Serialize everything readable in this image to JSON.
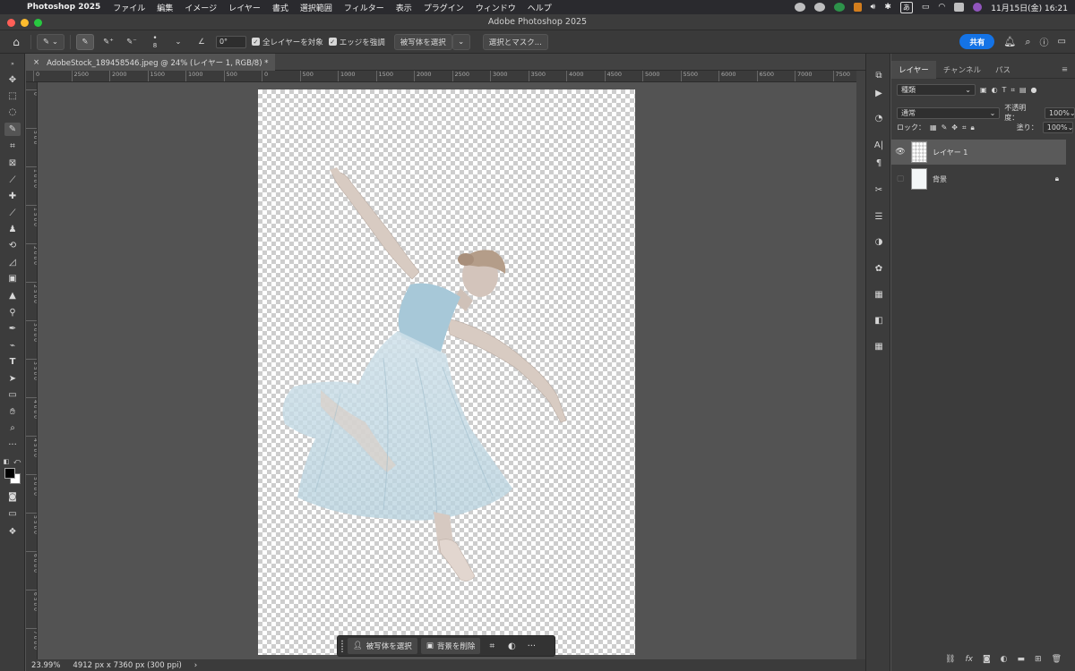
{
  "menubar": {
    "app": "Photoshop 2025",
    "menus": [
      "ファイル",
      "編集",
      "イメージ",
      "レイヤー",
      "書式",
      "選択範囲",
      "フィルター",
      "表示",
      "プラグイン",
      "ウィンドウ",
      "ヘルプ"
    ],
    "input_method": "あ",
    "datetime": "11月15日(金)  16:21"
  },
  "window": {
    "title": "Adobe Photoshop 2025"
  },
  "options": {
    "brush_size": "8",
    "angle": "0°",
    "sample_all_layers": "全レイヤーを対象",
    "enhance_edge": "エッジを強調",
    "select_subject": "被写体を選択",
    "select_mask": "選択とマスク...",
    "share": "共有"
  },
  "document": {
    "tab_title": "AdobeStock_189458546.jpeg @ 24% (レイヤー 1, RGB/8) *",
    "close": "×"
  },
  "ruler": {
    "h_labels": [
      "0",
      "2500",
      "2000",
      "1500",
      "1000",
      "500",
      "0",
      "500",
      "1000",
      "1500",
      "2000",
      "2500",
      "3000",
      "3500",
      "4000",
      "4500",
      "5000",
      "5500",
      "6000",
      "6500",
      "7000",
      "7500"
    ],
    "v_labels": [
      "0",
      "5 0 0",
      "1 0 0 0",
      "1 5 0 0",
      "2 0 0 0",
      "2 5 0 0",
      "3 0 0 0",
      "3 5 0 0",
      "4 0 0 0",
      "4 5 0 0",
      "5 0 0 0",
      "5 5 0 0",
      "6 0 0 0",
      "6 5 0 0",
      "7 0 0 0"
    ]
  },
  "taskbar": {
    "select_subject": "被写体を選択",
    "remove_background": "背景を削除",
    "more": "···"
  },
  "status": {
    "zoom": "23.99%",
    "doc_info": "4912 px x 7360 px (300 ppi)",
    "arrow": "›"
  },
  "layers_panel": {
    "tabs": [
      "レイヤー",
      "チャンネル",
      "パス"
    ],
    "filter_kind": "種類",
    "blend_mode": "通常",
    "opacity_label": "不透明度：",
    "opacity_value": "100%",
    "lock_label": "ロック：",
    "fill_label": "塗り：",
    "fill_value": "100%",
    "layers": [
      {
        "name": "レイヤー 1",
        "visible": true,
        "selected": true
      },
      {
        "name": "背景",
        "visible": false,
        "selected": false,
        "locked": true
      }
    ]
  },
  "colors": {
    "accent": "#1473e6",
    "traffic_red": "#ff5f57",
    "traffic_yellow": "#febc2e",
    "traffic_green": "#28c840"
  }
}
